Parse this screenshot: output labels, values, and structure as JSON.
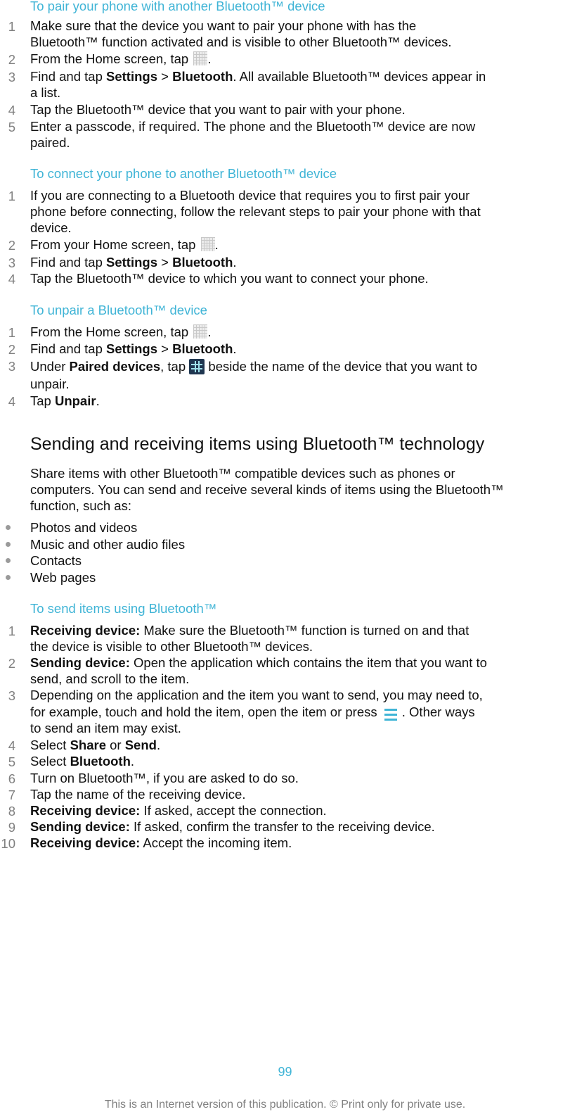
{
  "section_pair": {
    "title": "To pair your phone with another Bluetooth™ device",
    "steps": [
      {
        "n": "1",
        "lines": [
          "Make sure that the device you want to pair your phone with has the",
          "Bluetooth™ function activated and is visible to other Bluetooth™ devices."
        ]
      },
      {
        "n": "2",
        "pre": "From the Home screen, tap ",
        "post": "."
      },
      {
        "n": "3",
        "pre": "Find and tap ",
        "b1": "Settings",
        "mid": " > ",
        "b2": "Bluetooth",
        "post": ". All available Bluetooth™ devices appear in",
        "line2": "a list."
      },
      {
        "n": "4",
        "text": "Tap the Bluetooth™ device that you want to pair with your phone."
      },
      {
        "n": "5",
        "lines": [
          "Enter a passcode, if required. The phone and the Bluetooth™ device are now",
          "paired."
        ]
      }
    ]
  },
  "section_connect": {
    "title": "To connect your phone to another Bluetooth™ device",
    "steps": [
      {
        "n": "1",
        "lines": [
          "If you are connecting to a Bluetooth device that requires you to first pair your",
          "phone before connecting, follow the relevant steps to pair your phone with that",
          "device."
        ]
      },
      {
        "n": "2",
        "pre": "From your Home screen, tap ",
        "post": "."
      },
      {
        "n": "3",
        "pre": "Find and tap ",
        "b1": "Settings",
        "mid": " > ",
        "b2": "Bluetooth",
        "post": "."
      },
      {
        "n": "4",
        "text": "Tap the Bluetooth™ device to which you want to connect your phone."
      }
    ]
  },
  "section_unpair": {
    "title": "To unpair a Bluetooth™ device",
    "steps": [
      {
        "n": "1",
        "pre": "From the Home screen, tap ",
        "post": "."
      },
      {
        "n": "2",
        "pre": "Find and tap ",
        "b1": "Settings",
        "mid": " > ",
        "b2": "Bluetooth",
        "post": "."
      },
      {
        "n": "3",
        "pre": "Under ",
        "b1": "Paired devices",
        "mid": ", tap ",
        "post": " beside the name of the device that you want to",
        "line2": "unpair."
      },
      {
        "n": "4",
        "pre": "Tap ",
        "b1": "Unpair",
        "post": "."
      }
    ]
  },
  "section_sending": {
    "title": "Sending and receiving items using Bluetooth™ technology",
    "intro": [
      "Share items with other Bluetooth™ compatible devices such as phones or",
      "computers. You can send and receive several kinds of items using the Bluetooth™",
      "function, such as:"
    ],
    "bullets": [
      "Photos and videos",
      "Music and other audio files",
      "Contacts",
      "Web pages"
    ]
  },
  "section_send": {
    "title": "To send items using Bluetooth™",
    "steps": [
      {
        "n": "1",
        "b1": "Receiving device:",
        "post": " Make sure the Bluetooth™ function is turned on and that",
        "line2": "the device is visible to other Bluetooth™ devices."
      },
      {
        "n": "2",
        "b1": "Sending device:",
        "post": " Open the application which contains the item that you want to",
        "line2": "send, and scroll to the item."
      },
      {
        "n": "3",
        "line1": "Depending on the application and the item you want to send, you may need to,",
        "pre": "for example, touch and hold the item, open the item or press ",
        "post": ". Other ways",
        "line3": "to send an item may exist."
      },
      {
        "n": "4",
        "pre": "Select ",
        "b1": "Share",
        "mid": " or ",
        "b2": "Send",
        "post": "."
      },
      {
        "n": "5",
        "pre": "Select ",
        "b1": "Bluetooth",
        "post": "."
      },
      {
        "n": "6",
        "text": "Turn on Bluetooth™, if you are asked to do so."
      },
      {
        "n": "7",
        "text": "Tap the name of the receiving device."
      },
      {
        "n": "8",
        "b1": "Receiving device:",
        "post": " If asked, accept the connection."
      },
      {
        "n": "9",
        "b1": "Sending device:",
        "post": " If asked, confirm the transfer to the receiving device."
      },
      {
        "n": "10",
        "b1": "Receiving device:",
        "post": " Accept the incoming item."
      }
    ]
  },
  "footer": {
    "page_number": "99",
    "note": "This is an Internet version of this publication. © Print only for private use."
  },
  "icons": {
    "apps_grid": "apps-grid-icon",
    "device_settings": "device-settings-icon",
    "menu": "menu-icon"
  },
  "colors": {
    "accent": "#3fb4d6",
    "text": "#111111",
    "muted": "#808080"
  }
}
